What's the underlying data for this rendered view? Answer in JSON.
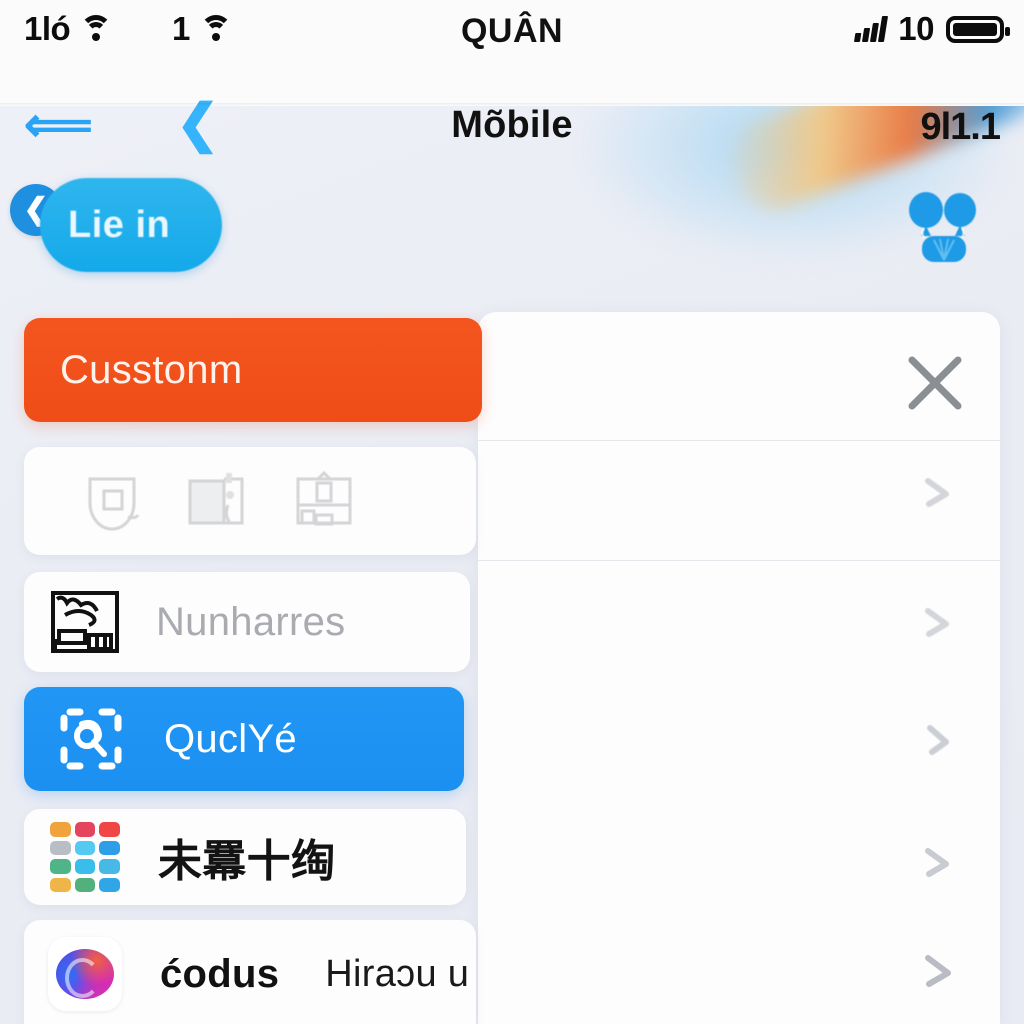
{
  "status_bar": {
    "left_indicator_1": "1ló",
    "left_indicator_1_icon": "wifi-icon",
    "left_indicator_2": "1",
    "left_indicator_2_icon": "wifi-icon",
    "signal_icon": "cellular-signal-icon",
    "signal_value": "10",
    "battery_icon": "battery-icon",
    "title_line_1": "QUÂN",
    "title_line_2": "Mõbile",
    "back_arrow_icon": "arrow-left-icon",
    "back_chevron_icon": "chevron-left-icon",
    "right_value": "9l1.1"
  },
  "header": {
    "back_button_icon": "chevron-left-icon",
    "pill_label": "Lie in",
    "right_icon": "balloons-icon"
  },
  "right_panel": {
    "close_icon": "close-icon",
    "chevron_icon": "chevron-right-icon"
  },
  "list": {
    "items": [
      {
        "id": "cusstonm",
        "label": "Cusstonm",
        "style": "orange",
        "icon": "none",
        "trailing_icon": "close-icon"
      },
      {
        "id": "icon-row",
        "label": "",
        "style": "plain",
        "icon": "triple-outline-icons",
        "icon_names": [
          "shield-outline-icon",
          "card-outline-icon",
          "box-outline-icon"
        ],
        "trailing_icon": "chevron-right-icon"
      },
      {
        "id": "nunharres",
        "label": "Nunharres",
        "style": "muted",
        "icon": "bed-sketch-icon",
        "trailing_icon": "chevron-right-icon"
      },
      {
        "id": "quclye",
        "label": "QuclYé",
        "style": "blue",
        "icon": "quick-scan-icon",
        "trailing_icon": "chevron-right-icon"
      },
      {
        "id": "cjk-row",
        "label": "未羃十绹",
        "style": "cjk",
        "icon": "app-grid-icon",
        "trailing_icon": "chevron-right-icon"
      },
      {
        "id": "codus",
        "label": "ćodus",
        "sublabel": "Hiraɔu u",
        "style": "dark",
        "icon": "codus-app-icon",
        "trailing_icon": "chevron-right-icon"
      }
    ]
  },
  "colors": {
    "accent_blue": "#2196f5",
    "accent_cyan": "#14a9ea",
    "accent_orange": "#f4551f",
    "background": "#eceef6",
    "card": "#fdfdfd",
    "muted_text": "#a9abb1",
    "divider": "#e4e6ec"
  }
}
